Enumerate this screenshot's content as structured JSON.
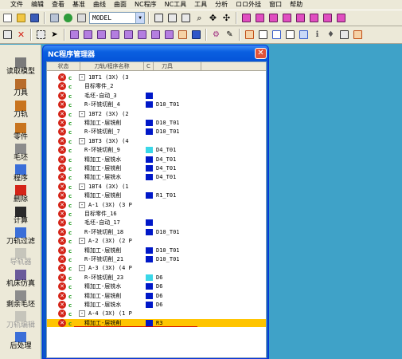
{
  "menu": [
    "文件",
    "编辑",
    "查看",
    "基准",
    "曲线",
    "曲面",
    "NC程序",
    "NC工具",
    "工具",
    "分析",
    "ロロ外挂",
    "窗口",
    "帮助"
  ],
  "toolbar": {
    "model_select": "MODEL"
  },
  "sidebar": [
    {
      "label": "读取模型",
      "icon": "read-model-icon",
      "enabled": true
    },
    {
      "label": "刀具",
      "icon": "tool-icon",
      "enabled": true
    },
    {
      "label": "刀轨",
      "icon": "toolpath-icon",
      "enabled": true
    },
    {
      "label": "零件",
      "icon": "part-icon",
      "enabled": true
    },
    {
      "label": "毛坯",
      "icon": "stock-icon",
      "enabled": true
    },
    {
      "label": "程序",
      "icon": "program-icon",
      "enabled": true
    },
    {
      "label": "删除",
      "icon": "delete-icon",
      "enabled": true
    },
    {
      "label": "计算",
      "icon": "calculate-icon",
      "enabled": true
    },
    {
      "label": "刀轨过滤",
      "icon": "filter-icon",
      "enabled": true
    },
    {
      "label": "导轨器",
      "icon": "guide-icon",
      "enabled": false
    },
    {
      "label": "机床仿真",
      "icon": "machine-sim-icon",
      "enabled": true
    },
    {
      "label": "剩余毛坯",
      "icon": "remaining-stock-icon",
      "enabled": true
    },
    {
      "label": "刀轨编辑",
      "icon": "toolpath-edit-icon",
      "enabled": false
    },
    {
      "label": "后处理",
      "icon": "postprocess-icon",
      "enabled": true
    }
  ],
  "dialog": {
    "title": "NC程序管理器",
    "columns": {
      "status": "状态",
      "name": "刀轨/程序名称",
      "c": "C",
      "tool": "刀具"
    },
    "rows": [
      {
        "level": 0,
        "name": "1BT1 (3X) (3",
        "tool": "",
        "color": "",
        "expand": "-"
      },
      {
        "level": 1,
        "name": "目标零件_2",
        "tool": "",
        "color": ""
      },
      {
        "level": 1,
        "name": "毛坯-自动_3",
        "tool": "",
        "color": "#0018c8"
      },
      {
        "level": 1,
        "name": "R-环铣切削_4",
        "tool": "D10_T01",
        "color": "#0018c8"
      },
      {
        "level": 0,
        "name": "1BT2 (3X) (2",
        "tool": "",
        "color": "",
        "expand": "-"
      },
      {
        "level": 1,
        "name": "精加工-层铣削",
        "tool": "D10_T01",
        "color": "#0018c8"
      },
      {
        "level": 1,
        "name": "R-环铣切削_7",
        "tool": "D10_T01",
        "color": "#0018c8"
      },
      {
        "level": 0,
        "name": "1BT3 (3X) (4",
        "tool": "",
        "color": "",
        "expand": "-"
      },
      {
        "level": 1,
        "name": "R-环铣切削_9",
        "tool": "D4_T01",
        "color": "#3ad7e8"
      },
      {
        "level": 1,
        "name": "精加工-层铣水",
        "tool": "D4_T01",
        "color": "#0018c8"
      },
      {
        "level": 1,
        "name": "精加工-层铣削",
        "tool": "D4_T01",
        "color": "#0018c8"
      },
      {
        "level": 1,
        "name": "精加工-层铣水",
        "tool": "D4_T01",
        "color": "#0018c8"
      },
      {
        "level": 0,
        "name": "1BT4 (3X) (1",
        "tool": "",
        "color": "",
        "expand": "-"
      },
      {
        "level": 1,
        "name": "精加工-层铣削",
        "tool": "R1_T01",
        "color": "#0018c8"
      },
      {
        "level": 0,
        "name": "A-1 (3X) (3 P",
        "tool": "",
        "color": "",
        "expand": "-"
      },
      {
        "level": 1,
        "name": "目标零件_16",
        "tool": "",
        "color": ""
      },
      {
        "level": 1,
        "name": "毛坯-自动_17",
        "tool": "",
        "color": "#0018c8"
      },
      {
        "level": 1,
        "name": "R-环铣切削_18",
        "tool": "D10_T01",
        "color": "#0018c8"
      },
      {
        "level": 0,
        "name": "A-2 (3X) (2 P",
        "tool": "",
        "color": "",
        "expand": "-"
      },
      {
        "level": 1,
        "name": "精加工-层铣削",
        "tool": "D10_T01",
        "color": "#0018c8"
      },
      {
        "level": 1,
        "name": "R-环铣切削_21",
        "tool": "D10_T01",
        "color": "#0018c8"
      },
      {
        "level": 0,
        "name": "A-3 (3X) (4 P",
        "tool": "",
        "color": "",
        "expand": "-"
      },
      {
        "level": 1,
        "name": "R-环铣切削_23",
        "tool": "D6",
        "color": "#3ad7e8"
      },
      {
        "level": 1,
        "name": "精加工-层铣水",
        "tool": "D6",
        "color": "#0018c8"
      },
      {
        "level": 1,
        "name": "精加工-层铣削",
        "tool": "D6",
        "color": "#0018c8"
      },
      {
        "level": 1,
        "name": "精加工-层铣水",
        "tool": "D6",
        "color": "#0018c8"
      },
      {
        "level": 0,
        "name": "A-4 (3X) (1 P",
        "tool": "",
        "color": "",
        "expand": "-"
      },
      {
        "level": 1,
        "name": "精加工-层铣削",
        "tool": "R3",
        "color": "#0018c8",
        "selected": true
      }
    ]
  }
}
